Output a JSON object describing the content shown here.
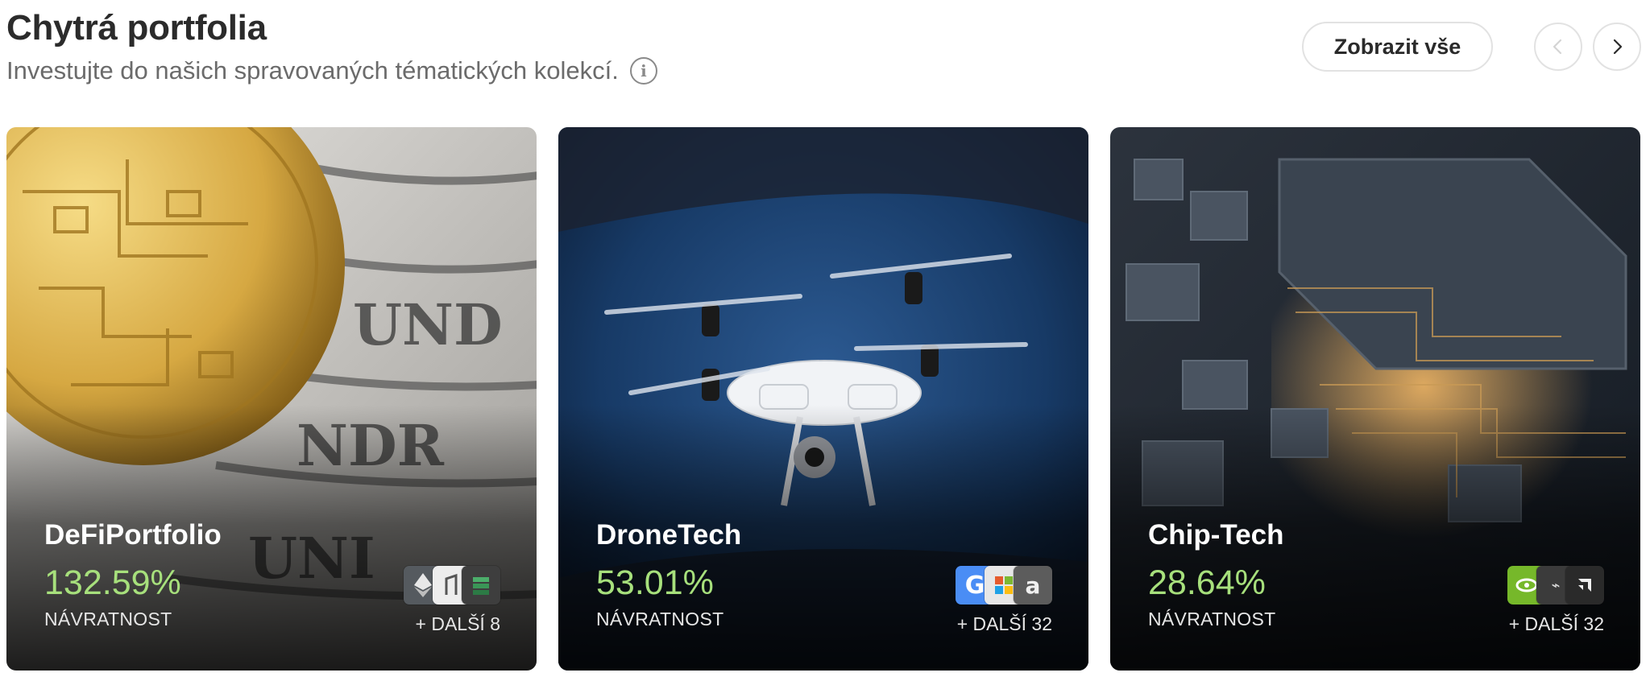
{
  "header": {
    "title": "Chytrá portfolia",
    "subtitle": "Investujte do našich spravovaných tématických kolekcí.",
    "info_icon": "info-icon",
    "view_all_label": "Zobrazit vše",
    "prev_icon": "chevron-left-icon",
    "next_icon": "chevron-right-icon"
  },
  "cards": [
    {
      "name": "DeFiPortfolio",
      "return_value": "132.59%",
      "return_label": "NÁVRATNOST",
      "more": "+ DALŠÍ 8",
      "logos": [
        "ethereum-logo",
        "bitcoin-logo",
        "stacked-blocks-logo"
      ]
    },
    {
      "name": "DroneTech",
      "return_value": "53.01%",
      "return_label": "NÁVRATNOST",
      "more": "+ DALŠÍ 32",
      "logos": [
        "google-logo",
        "microsoft-logo",
        "amazon-logo"
      ]
    },
    {
      "name": "Chip-Tech",
      "return_value": "28.64%",
      "return_label": "NÁVRATNOST",
      "more": "+ DALŠÍ 32",
      "logos": [
        "nvidia-logo",
        "tesla-logo",
        "amd-logo"
      ]
    }
  ],
  "colors": {
    "return_green": "#a7e07c",
    "title": "#2b2b2b",
    "subtitle": "#6b6b6b"
  }
}
